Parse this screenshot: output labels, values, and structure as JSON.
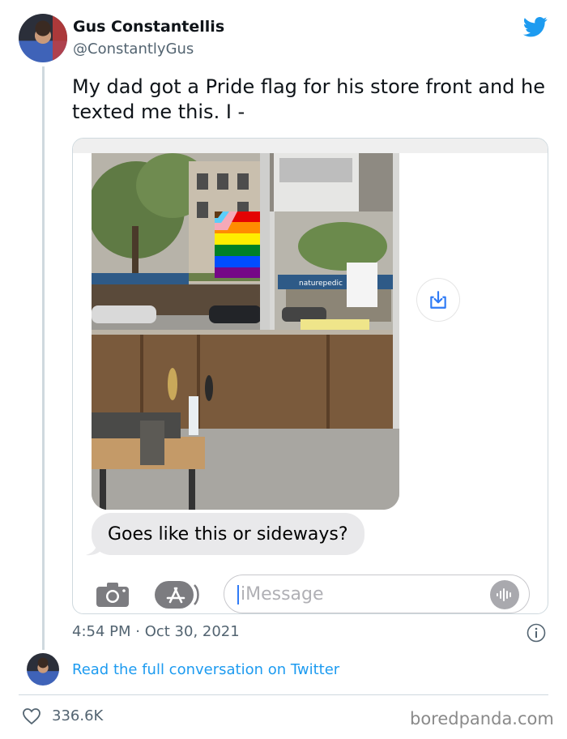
{
  "author": {
    "display_name": "Gus Constantellis",
    "handle": "@ConstantlyGus"
  },
  "tweet": {
    "text": "My dad got a Pride flag for his store front and he texted me this. I -"
  },
  "screenshot": {
    "message_bubble": "Goes like this or sideways?",
    "input_placeholder": "iMessage",
    "storefront_sign": "naturepedic"
  },
  "meta": {
    "timestamp": "4:54 PM · Oct 30, 2021",
    "read_more": "Read the full conversation on Twitter",
    "likes": "336.6K"
  },
  "watermark": "boredpanda.com",
  "colors": {
    "accent": "#1d9bf0",
    "text": "#0f1419",
    "secondary": "#536471"
  },
  "icons": [
    "twitter-bird-icon",
    "download-icon",
    "camera-icon",
    "app-store-icon",
    "audio-waveform-icon",
    "info-icon",
    "heart-icon"
  ]
}
